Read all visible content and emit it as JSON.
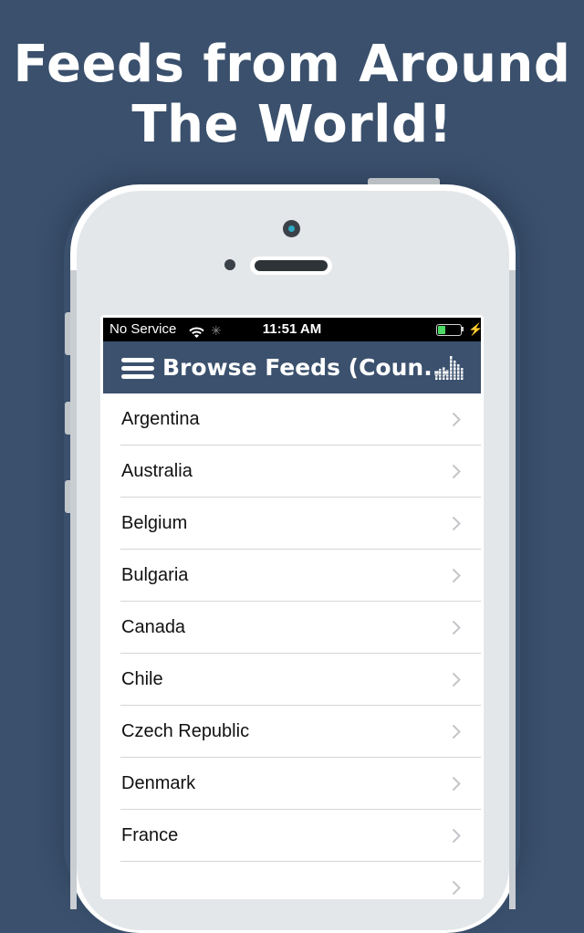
{
  "headline": {
    "line1": "Feeds from Around",
    "line2": "The World!"
  },
  "status_bar": {
    "carrier": "No Service",
    "wifi_icon": "wifi-icon",
    "activity_icon": "activity-spinner-icon",
    "time": "11:51 AM",
    "battery_level": 0.35,
    "battery_color": "#4cd964",
    "charging_icon": "charging-bolt-icon"
  },
  "nav_bar": {
    "menu_icon": "hamburger-menu-icon",
    "title": "Browse Feeds (Coun...",
    "right_icon": "equalizer-icon",
    "background": "#3b516e"
  },
  "countries": [
    {
      "label": "Argentina"
    },
    {
      "label": "Australia"
    },
    {
      "label": "Belgium"
    },
    {
      "label": "Bulgaria"
    },
    {
      "label": "Canada"
    },
    {
      "label": "Chile"
    },
    {
      "label": "Czech Republic"
    },
    {
      "label": "Denmark"
    },
    {
      "label": "France"
    },
    {
      "label": ""
    }
  ],
  "colors": {
    "page_background": "#3a506c",
    "accent": "#3b516e"
  }
}
